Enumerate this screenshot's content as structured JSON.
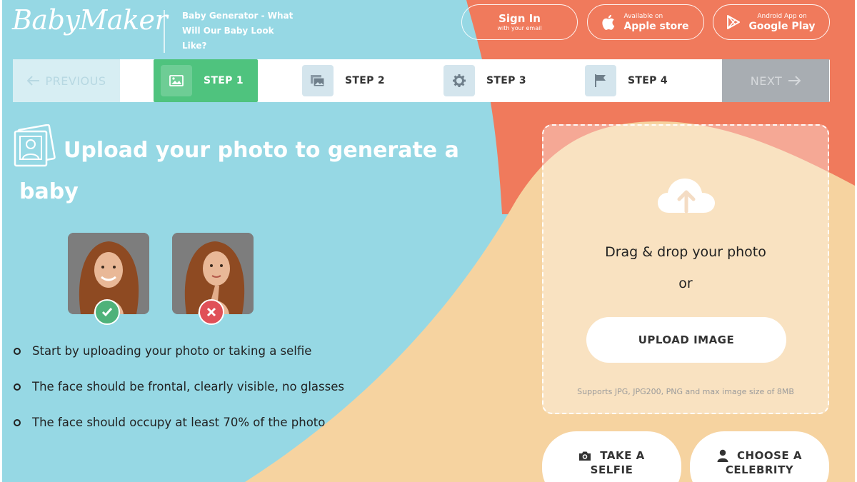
{
  "header": {
    "logo": "BabyMaker",
    "tagline": "Baby Generator - What Will Our Baby Look Like?",
    "signin": {
      "label": "Sign In",
      "sublabel": "with your email"
    },
    "apple": {
      "sublabel": "Available on",
      "label": "Apple store"
    },
    "google": {
      "sublabel": "Android App on",
      "label": "Google Play"
    }
  },
  "stepbar": {
    "previous": "PREVIOUS",
    "next": "NEXT",
    "steps": [
      {
        "label": "STEP 1",
        "icon": "image-icon",
        "active": true
      },
      {
        "label": "STEP 2",
        "icon": "images-icon",
        "active": false
      },
      {
        "label": "STEP 3",
        "icon": "gear-icon",
        "active": false
      },
      {
        "label": "STEP 4",
        "icon": "flag-icon",
        "active": false
      }
    ]
  },
  "main": {
    "title": "Upload your photo to generate a baby",
    "tips": [
      "Start by uploading your photo or taking a selfie",
      "The face should be frontal, clearly visible, no glasses",
      "The face should occupy at least 70% of the photo"
    ]
  },
  "dropzone": {
    "drag_text": "Drag & drop your photo",
    "or_text": "or",
    "upload_button": "UPLOAD IMAGE",
    "support_text": "Supports JPG, JPG200, PNG and max image size of 8MB"
  },
  "actions": {
    "selfie": {
      "line1": "TAKE A",
      "line2": "SELFIE"
    },
    "celebrity": {
      "line1": "CHOOSE A",
      "line2": "CELEBRITY"
    }
  },
  "colors": {
    "sky": "#96d8e4",
    "coral": "#f07a5c",
    "peach": "#f6d3a0",
    "green": "#4fc37e",
    "red": "#e05058"
  }
}
